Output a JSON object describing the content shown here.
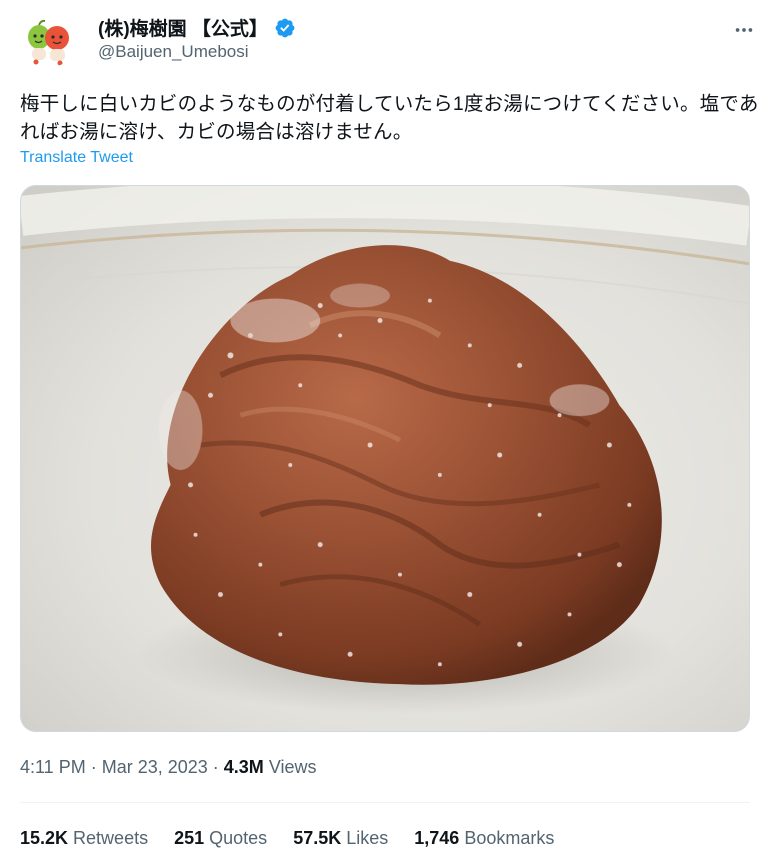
{
  "author": {
    "display_name": "(株)梅樹園 【公式】",
    "handle": "@Baijuen_Umebosi",
    "avatar_icon": "mascot-avatar-icon",
    "verified_icon": "verified-badge-icon",
    "verified_color": "#1d9bf0"
  },
  "tweet": {
    "text": "梅干しに白いカビのようなものが付着していたら1度お湯につけてください。塩であればお湯に溶け、カビの場合は溶けません。",
    "translate_label": "Translate Tweet"
  },
  "media": {
    "alt_icon": "umeboshi-photo"
  },
  "meta": {
    "time": "4:11 PM",
    "separator": "·",
    "date": "Mar 23, 2023",
    "views_count": "4.3M",
    "views_label": "Views"
  },
  "stats": [
    {
      "count": "15.2K",
      "label": "Retweets"
    },
    {
      "count": "251",
      "label": "Quotes"
    },
    {
      "count": "57.5K",
      "label": "Likes"
    },
    {
      "count": "1,746",
      "label": "Bookmarks"
    }
  ],
  "colors": {
    "text_primary": "#0f1419",
    "text_secondary": "#536471",
    "link": "#1d9bf0"
  }
}
